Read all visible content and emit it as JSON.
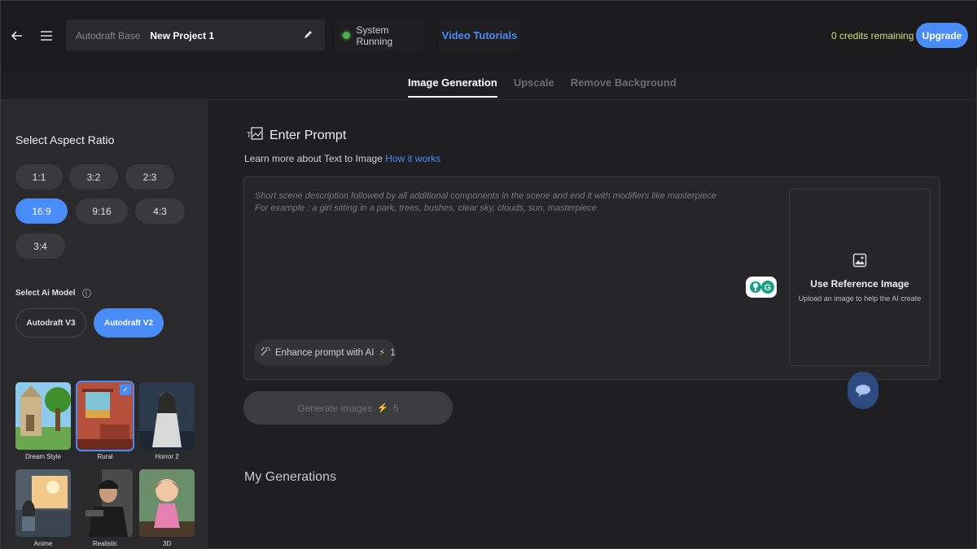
{
  "header": {
    "project_base": "Autodraft Base",
    "project_name": "New Project 1",
    "system_status": "System Running",
    "video_tutorials": "Video Tutorials",
    "credits": "0 credits remaining",
    "upgrade_label": "Upgrade"
  },
  "tabs": [
    {
      "label": "Image Generation",
      "active": true
    },
    {
      "label": "Upscale",
      "active": false
    },
    {
      "label": "Remove Background",
      "active": false
    }
  ],
  "sidebar": {
    "aspect_title": "Select Aspect Ratio",
    "ratios": [
      {
        "label": "1:1",
        "active": false
      },
      {
        "label": "3:2",
        "active": false
      },
      {
        "label": "2:3",
        "active": false
      },
      {
        "label": "16:9",
        "active": true
      },
      {
        "label": "9:16",
        "active": false
      },
      {
        "label": "4:3",
        "active": false
      },
      {
        "label": "3:4",
        "active": false
      }
    ],
    "model_title": "Select Ai Model",
    "models": [
      {
        "label": "Autodraft V3",
        "active": false
      },
      {
        "label": "Autodraft V2",
        "active": true
      }
    ],
    "styles": [
      {
        "label": "Dream Style",
        "selected": false
      },
      {
        "label": "Rural",
        "selected": true
      },
      {
        "label": "Horror 2",
        "selected": false
      },
      {
        "label": "Anime",
        "selected": false
      },
      {
        "label": "Realistic",
        "selected": false
      },
      {
        "label": "3D",
        "selected": false
      }
    ]
  },
  "main": {
    "prompt_title": "Enter Prompt",
    "learn_more": "Learn more about Text to Image",
    "how_it_works": "How it works",
    "placeholder": "Short scene description followed by all additional components in the scene and end it with modifiers like masterpiece\nFor example : a girl sitting in a park, trees, bushes, clear sky, clouds, sun, masterpiece",
    "enhance_label": "Enhance prompt with AI",
    "enhance_cost": "1",
    "ref_title": "Use Reference Image",
    "ref_subtitle": "Upload an image to help the AI create",
    "generate_label": "Generate images",
    "generate_cost": "5",
    "my_generations": "My Generations"
  },
  "colors": {
    "accent": "#4a8cf7",
    "status_green": "#4caf50",
    "credits": "#c8e37a"
  }
}
